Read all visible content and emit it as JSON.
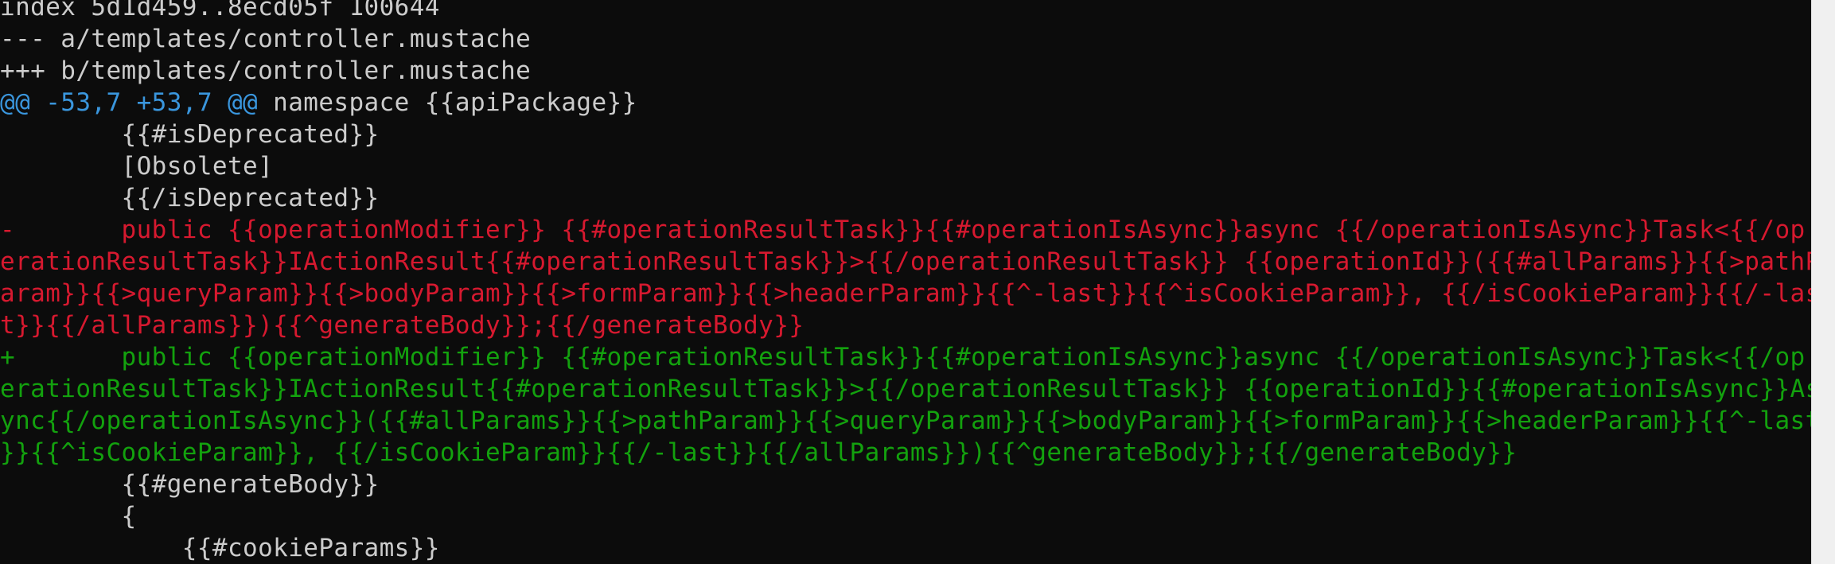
{
  "terminal": {
    "lines": [
      {
        "text": "index 5d1d459..8ecd05f 100644",
        "color": "white"
      },
      {
        "text": "--- a/templates/controller.mustache",
        "color": "white"
      },
      {
        "text": "+++ b/templates/controller.mustache",
        "color": "white"
      },
      {
        "text": "",
        "color": "hunk"
      },
      {
        "text": "        {{#isDeprecated}}",
        "color": "white"
      },
      {
        "text": "        [Obsolete]",
        "color": "white"
      },
      {
        "text": "        {{/isDeprecated}}",
        "color": "white"
      },
      {
        "text": "-       public {{operationModifier}} {{#operationResultTask}}{{#operationIsAsync}}async {{/operationIsAsync}}Task<{{/op",
        "color": "red"
      },
      {
        "text": "erationResultTask}}IActionResult{{#operationResultTask}}>{{/operationResultTask}} {{operationId}}({{#allParams}}{{>pathP",
        "color": "red"
      },
      {
        "text": "aram}}{{>queryParam}}{{>bodyParam}}{{>formParam}}{{>headerParam}}{{^-last}}{{^isCookieParam}}, {{/isCookieParam}}{{/-las",
        "color": "red"
      },
      {
        "text": "t}}{{/allParams}}){{^generateBody}};{{/generateBody}}",
        "color": "red"
      },
      {
        "text": "+       public {{operationModifier}} {{#operationResultTask}}{{#operationIsAsync}}async {{/operationIsAsync}}Task<{{/op",
        "color": "green"
      },
      {
        "text": "erationResultTask}}IActionResult{{#operationResultTask}}>{{/operationResultTask}} {{operationId}}{{#operationIsAsync}}As",
        "color": "green"
      },
      {
        "text": "ync{{/operationIsAsync}}({{#allParams}}{{>pathParam}}{{>queryParam}}{{>bodyParam}}{{>formParam}}{{>headerParam}}{{^-last",
        "color": "green"
      },
      {
        "text": "}}{{^isCookieParam}}, {{/isCookieParam}}{{/-last}}{{/allParams}}){{^generateBody}};{{/generateBody}}",
        "color": "green"
      },
      {
        "text": "        {{#generateBody}}",
        "color": "white"
      },
      {
        "text": "        {",
        "color": "white"
      },
      {
        "text": "            {{#cookieParams}}",
        "color": "white"
      }
    ],
    "hunk_header": {
      "marker": "@@ -53,7 +53,7 @@",
      "context": " namespace {{apiPackage}}"
    },
    "colors": {
      "background": "#0c0c0c",
      "text": "#cccccc",
      "removed": "#d6192f",
      "added": "#13a10e",
      "hunk": "#3a96dd",
      "scrollbar": "#f0f0f0"
    }
  }
}
